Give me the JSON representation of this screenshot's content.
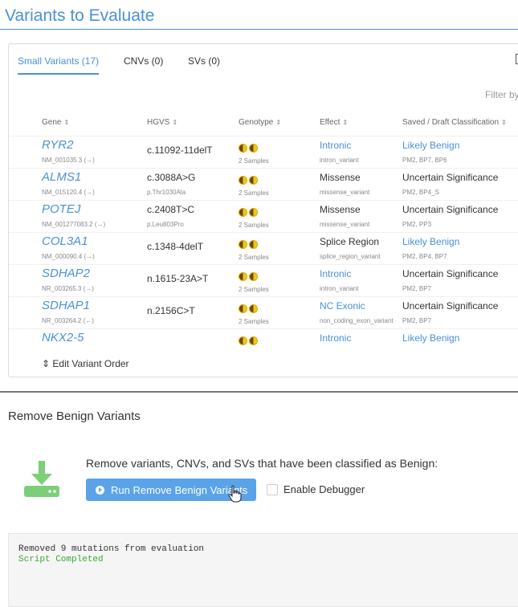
{
  "page_title": "Variants to Evaluate",
  "tabs": [
    {
      "label": "Small Variants (17)",
      "active": true
    },
    {
      "label": "CNVs (0)",
      "active": false
    },
    {
      "label": "SVs (0)",
      "active": false
    }
  ],
  "filter_label": "Filter by",
  "columns": {
    "gene": "Gene",
    "hgvs": "HGVS",
    "genotype": "Genotype",
    "effect": "Effect",
    "classification": "Saved / Draft Classification"
  },
  "rows": [
    {
      "gene": "RYR2",
      "transcript": "NM_001035.3 (→)",
      "hgvs": "c.11092-11delT",
      "protein": "",
      "samples": "2 Samples",
      "effect": "Intronic",
      "effect_link": true,
      "consequence": "intron_variant",
      "classification": "Likely Benign",
      "classification_link": true,
      "criteria": "PM2, BP7, BP6"
    },
    {
      "gene": "ALMS1",
      "transcript": "NM_015120.4 (→)",
      "hgvs": "c.3088A>G",
      "protein": "p.Thr1030Ala",
      "samples": "2 Samples",
      "effect": "Missense",
      "effect_link": false,
      "consequence": "missense_variant",
      "classification": "Uncertain Significance",
      "classification_link": false,
      "criteria": "PM2, BP4_S"
    },
    {
      "gene": "POTEJ",
      "transcript": "NM_001277083.2 (→)",
      "hgvs": "c.2408T>C",
      "protein": "p.Leu803Pro",
      "samples": "2 Samples",
      "effect": "Missense",
      "effect_link": false,
      "consequence": "missense_variant",
      "classification": "Uncertain Significance",
      "classification_link": false,
      "criteria": "PM2, PP3"
    },
    {
      "gene": "COL3A1",
      "transcript": "NM_000090.4 (→)",
      "hgvs": "c.1348-4delT",
      "protein": "",
      "samples": "2 Samples",
      "effect": "Splice Region",
      "effect_link": false,
      "consequence": "splice_region_variant",
      "classification": "Likely Benign",
      "classification_link": true,
      "criteria": "PM2, BP4, BP7"
    },
    {
      "gene": "SDHAP2",
      "transcript": "NR_003265.3 (→)",
      "hgvs": "n.1615-23A>T",
      "protein": "",
      "samples": "2 Samples",
      "effect": "Intronic",
      "effect_link": true,
      "consequence": "intron_variant",
      "classification": "Uncertain Significance",
      "classification_link": false,
      "criteria": "PM2, BP7"
    },
    {
      "gene": "SDHAP1",
      "transcript": "NR_003264.2 (←)",
      "hgvs": "n.2156C>T",
      "protein": "",
      "samples": "2 Samples",
      "effect": "NC Exonic",
      "effect_link": true,
      "consequence": "non_coding_exon_variant",
      "classification": "Uncertain Significance",
      "classification_link": false,
      "criteria": "PM2, BP7"
    },
    {
      "gene": "NKX2-5",
      "transcript": "",
      "hgvs": "",
      "protein": "",
      "samples": "",
      "effect": "Intronic",
      "effect_link": true,
      "consequence": "",
      "classification": "Likely Benign",
      "classification_link": true,
      "criteria": ""
    }
  ],
  "edit_order_label": "⇕ Edit Variant Order",
  "remove_section": {
    "title": "Remove Benign Variants",
    "description": "Remove variants, CNVs, and SVs that have been classified as Benign:",
    "run_label": "Run Remove Benign Variants",
    "debugger_label": "Enable Debugger",
    "debugger_checked": false
  },
  "console": {
    "lines": [
      {
        "text": "Removed 9 mutations from evaluation",
        "color": "#333333"
      },
      {
        "text": "Script Completed",
        "color": "#3aaa35"
      }
    ]
  },
  "colors": {
    "accent": "#4a90d9",
    "button": "#5aa3e8",
    "icon": "#7ccf79",
    "success": "#3aaa35"
  }
}
